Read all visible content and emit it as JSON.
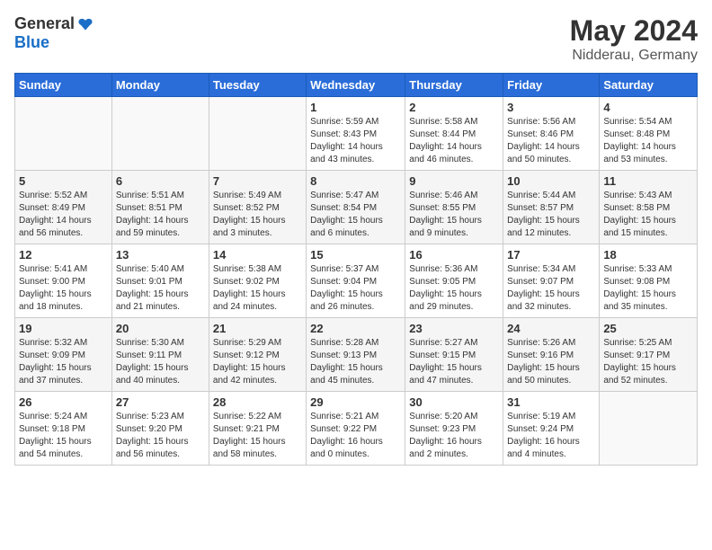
{
  "logo": {
    "general": "General",
    "blue": "Blue"
  },
  "title": {
    "month": "May 2024",
    "location": "Nidderau, Germany"
  },
  "weekdays": [
    "Sunday",
    "Monday",
    "Tuesday",
    "Wednesday",
    "Thursday",
    "Friday",
    "Saturday"
  ],
  "weeks": [
    [
      {
        "day": "",
        "info": ""
      },
      {
        "day": "",
        "info": ""
      },
      {
        "day": "",
        "info": ""
      },
      {
        "day": "1",
        "info": "Sunrise: 5:59 AM\nSunset: 8:43 PM\nDaylight: 14 hours\nand 43 minutes."
      },
      {
        "day": "2",
        "info": "Sunrise: 5:58 AM\nSunset: 8:44 PM\nDaylight: 14 hours\nand 46 minutes."
      },
      {
        "day": "3",
        "info": "Sunrise: 5:56 AM\nSunset: 8:46 PM\nDaylight: 14 hours\nand 50 minutes."
      },
      {
        "day": "4",
        "info": "Sunrise: 5:54 AM\nSunset: 8:48 PM\nDaylight: 14 hours\nand 53 minutes."
      }
    ],
    [
      {
        "day": "5",
        "info": "Sunrise: 5:52 AM\nSunset: 8:49 PM\nDaylight: 14 hours\nand 56 minutes."
      },
      {
        "day": "6",
        "info": "Sunrise: 5:51 AM\nSunset: 8:51 PM\nDaylight: 14 hours\nand 59 minutes."
      },
      {
        "day": "7",
        "info": "Sunrise: 5:49 AM\nSunset: 8:52 PM\nDaylight: 15 hours\nand 3 minutes."
      },
      {
        "day": "8",
        "info": "Sunrise: 5:47 AM\nSunset: 8:54 PM\nDaylight: 15 hours\nand 6 minutes."
      },
      {
        "day": "9",
        "info": "Sunrise: 5:46 AM\nSunset: 8:55 PM\nDaylight: 15 hours\nand 9 minutes."
      },
      {
        "day": "10",
        "info": "Sunrise: 5:44 AM\nSunset: 8:57 PM\nDaylight: 15 hours\nand 12 minutes."
      },
      {
        "day": "11",
        "info": "Sunrise: 5:43 AM\nSunset: 8:58 PM\nDaylight: 15 hours\nand 15 minutes."
      }
    ],
    [
      {
        "day": "12",
        "info": "Sunrise: 5:41 AM\nSunset: 9:00 PM\nDaylight: 15 hours\nand 18 minutes."
      },
      {
        "day": "13",
        "info": "Sunrise: 5:40 AM\nSunset: 9:01 PM\nDaylight: 15 hours\nand 21 minutes."
      },
      {
        "day": "14",
        "info": "Sunrise: 5:38 AM\nSunset: 9:02 PM\nDaylight: 15 hours\nand 24 minutes."
      },
      {
        "day": "15",
        "info": "Sunrise: 5:37 AM\nSunset: 9:04 PM\nDaylight: 15 hours\nand 26 minutes."
      },
      {
        "day": "16",
        "info": "Sunrise: 5:36 AM\nSunset: 9:05 PM\nDaylight: 15 hours\nand 29 minutes."
      },
      {
        "day": "17",
        "info": "Sunrise: 5:34 AM\nSunset: 9:07 PM\nDaylight: 15 hours\nand 32 minutes."
      },
      {
        "day": "18",
        "info": "Sunrise: 5:33 AM\nSunset: 9:08 PM\nDaylight: 15 hours\nand 35 minutes."
      }
    ],
    [
      {
        "day": "19",
        "info": "Sunrise: 5:32 AM\nSunset: 9:09 PM\nDaylight: 15 hours\nand 37 minutes."
      },
      {
        "day": "20",
        "info": "Sunrise: 5:30 AM\nSunset: 9:11 PM\nDaylight: 15 hours\nand 40 minutes."
      },
      {
        "day": "21",
        "info": "Sunrise: 5:29 AM\nSunset: 9:12 PM\nDaylight: 15 hours\nand 42 minutes."
      },
      {
        "day": "22",
        "info": "Sunrise: 5:28 AM\nSunset: 9:13 PM\nDaylight: 15 hours\nand 45 minutes."
      },
      {
        "day": "23",
        "info": "Sunrise: 5:27 AM\nSunset: 9:15 PM\nDaylight: 15 hours\nand 47 minutes."
      },
      {
        "day": "24",
        "info": "Sunrise: 5:26 AM\nSunset: 9:16 PM\nDaylight: 15 hours\nand 50 minutes."
      },
      {
        "day": "25",
        "info": "Sunrise: 5:25 AM\nSunset: 9:17 PM\nDaylight: 15 hours\nand 52 minutes."
      }
    ],
    [
      {
        "day": "26",
        "info": "Sunrise: 5:24 AM\nSunset: 9:18 PM\nDaylight: 15 hours\nand 54 minutes."
      },
      {
        "day": "27",
        "info": "Sunrise: 5:23 AM\nSunset: 9:20 PM\nDaylight: 15 hours\nand 56 minutes."
      },
      {
        "day": "28",
        "info": "Sunrise: 5:22 AM\nSunset: 9:21 PM\nDaylight: 15 hours\nand 58 minutes."
      },
      {
        "day": "29",
        "info": "Sunrise: 5:21 AM\nSunset: 9:22 PM\nDaylight: 16 hours\nand 0 minutes."
      },
      {
        "day": "30",
        "info": "Sunrise: 5:20 AM\nSunset: 9:23 PM\nDaylight: 16 hours\nand 2 minutes."
      },
      {
        "day": "31",
        "info": "Sunrise: 5:19 AM\nSunset: 9:24 PM\nDaylight: 16 hours\nand 4 minutes."
      },
      {
        "day": "",
        "info": ""
      }
    ]
  ]
}
